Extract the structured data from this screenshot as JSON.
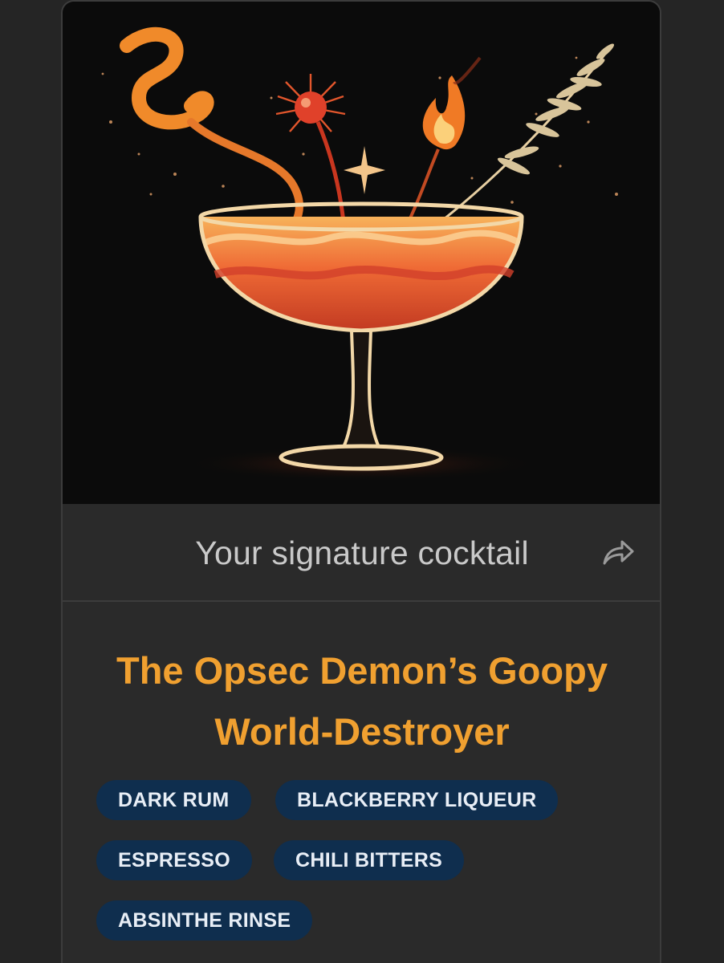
{
  "card": {
    "image": {
      "description_icon": "cocktail-coupe-illustration",
      "colors": {
        "background": "#0b0b0b",
        "orange": "#f0882a",
        "red": "#d8432c",
        "cream": "#f3d8a8"
      }
    },
    "caption": "Your signature cocktail",
    "share_icon": "share-arrow-icon",
    "title_line1": "The Opsec Demon’s Goopy",
    "title_line2": "World-Destroyer",
    "ingredients": [
      "DARK RUM",
      "BLACKBERRY LIQUEUR",
      "ESPRESSO",
      "CHILI BITTERS",
      "ABSINTHE RINSE"
    ]
  },
  "colors": {
    "title": "#f0a030",
    "chip_bg": "#0f2e4e",
    "chip_text": "#e8eef6",
    "caption": "#c9c9c9",
    "page_bg": "#252525"
  }
}
